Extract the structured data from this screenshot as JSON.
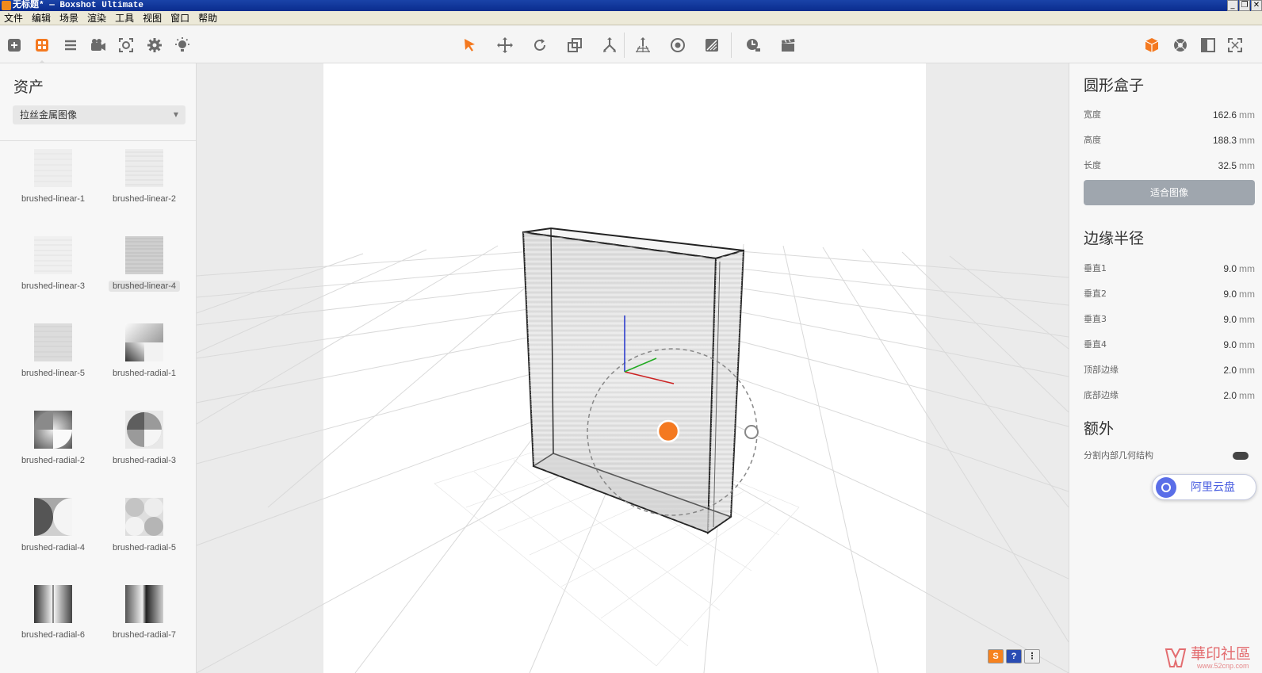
{
  "window": {
    "title": "无标题* — Boxshot Ultimate",
    "controls": [
      "_",
      "❐",
      "✕"
    ]
  },
  "menu": [
    "文件",
    "编辑",
    "场景",
    "渲染",
    "工具",
    "视图",
    "窗口",
    "帮助"
  ],
  "toolbar": {
    "left_icons": [
      "add-icon",
      "assets-icon",
      "list-icon",
      "camera-icon",
      "focus-icon",
      "settings-icon",
      "light-icon"
    ],
    "center_icons": [
      "select-icon",
      "move-icon",
      "rotate-icon",
      "scale-icon",
      "multi-move-icon",
      "ground-icon",
      "render-preview-icon",
      "material-icon",
      "time-icon",
      "clapper-icon"
    ],
    "right_icons": [
      "box-icon",
      "sphere-icon",
      "layout-icon",
      "fullscreen-icon"
    ],
    "accent_color": "#f47920"
  },
  "assets": {
    "title": "资产",
    "category": "拉丝金属图像",
    "items": [
      {
        "label": "brushed-linear-1"
      },
      {
        "label": "brushed-linear-2"
      },
      {
        "label": "brushed-linear-3"
      },
      {
        "label": "brushed-linear-4"
      },
      {
        "label": "brushed-linear-5"
      },
      {
        "label": "brushed-radial-1"
      },
      {
        "label": "brushed-radial-2"
      },
      {
        "label": "brushed-radial-3"
      },
      {
        "label": "brushed-radial-4"
      },
      {
        "label": "brushed-radial-5"
      },
      {
        "label": "brushed-radial-6"
      },
      {
        "label": "brushed-radial-7"
      }
    ],
    "selected": "brushed-linear-4"
  },
  "properties": {
    "object_title": "圆形盒子",
    "dimensions": [
      {
        "label": "宽度",
        "value": "162.6",
        "unit": "mm"
      },
      {
        "label": "高度",
        "value": "188.3",
        "unit": "mm"
      },
      {
        "label": "长度",
        "value": "32.5",
        "unit": "mm"
      }
    ],
    "fit_button": "适合图像",
    "radius_title": "边缘半径",
    "radius": [
      {
        "label": "垂直1",
        "value": "9.0",
        "unit": "mm"
      },
      {
        "label": "垂直2",
        "value": "9.0",
        "unit": "mm"
      },
      {
        "label": "垂直3",
        "value": "9.0",
        "unit": "mm"
      },
      {
        "label": "垂直4",
        "value": "9.0",
        "unit": "mm"
      },
      {
        "label": "顶部边缘",
        "value": "2.0",
        "unit": "mm"
      },
      {
        "label": "底部边缘",
        "value": "2.0",
        "unit": "mm"
      }
    ],
    "extra_title": "额外",
    "extra_option": "分割内部几何结构"
  },
  "overlay": {
    "aliyun_label": "阿里云盘",
    "watermark_main": "華印社區",
    "watermark_sub": "www.52cnp.com"
  }
}
